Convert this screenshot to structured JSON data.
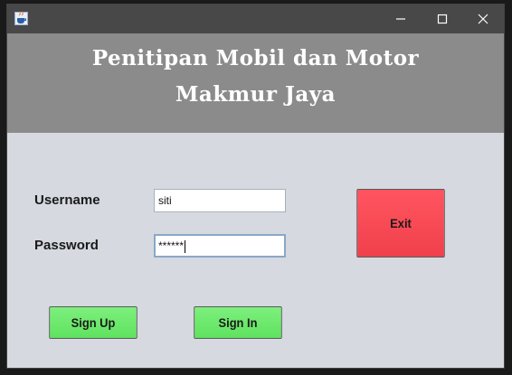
{
  "titlebar": {
    "icon": "java-icon",
    "minimize_icon": "minimize-icon",
    "maximize_icon": "maximize-icon",
    "close_icon": "close-icon"
  },
  "header": {
    "line1": "Penitipan Mobil dan Motor",
    "line2": "Makmur Jaya",
    "background": "#8b8b8b"
  },
  "form": {
    "username_label": "Username",
    "username_value": "siti",
    "password_label": "Password",
    "password_value": "******"
  },
  "buttons": {
    "signup": "Sign Up",
    "signin": "Sign In",
    "exit": "Exit"
  },
  "colors": {
    "green_button": "#6ee96e",
    "exit_button": "#f54652",
    "window_bg": "#d6d9e0"
  }
}
